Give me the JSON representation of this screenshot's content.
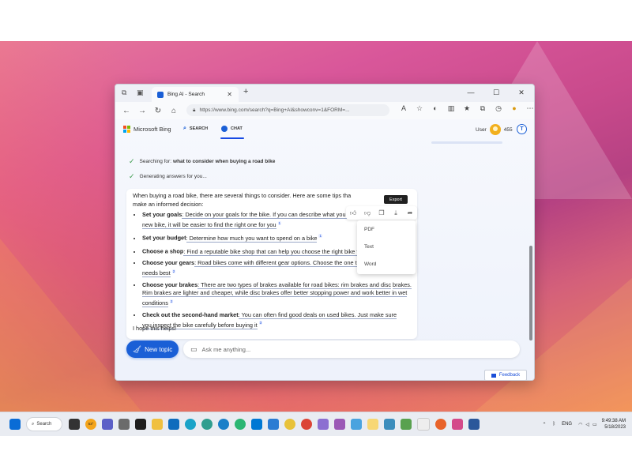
{
  "browser": {
    "tab_title": "Bing AI - Search",
    "url": "https://www.bing.com/search?q=Bing+AI&showconv=1&FORM=...",
    "new_tab": "+"
  },
  "bing": {
    "brand": "Microsoft Bing",
    "tabs": [
      "SEARCH",
      "CHAT"
    ],
    "active_tab": "CHAT",
    "user_label": "User",
    "points": "455"
  },
  "status": {
    "searching_prefix": "Searching for: ",
    "searching_query": "what to consider when buying a road bike",
    "generating": "Generating answers for you..."
  },
  "answer": {
    "intro": "When buying a road bike, there are several things to consider. Here are some tips tha",
    "intro2": "make an informed decision:",
    "items": [
      {
        "bold": "Set your goals",
        "text": ": Decide on your goals for the bike. If you can describe what you w",
        "text2": "new bike, it will be easier to find the right one for you",
        "ref": "1"
      },
      {
        "bold": "Set your budget",
        "text": ": Determine how much you want to spend on a bike",
        "text2": "",
        "ref": "1"
      },
      {
        "bold": "Choose a shop",
        "text": ": Find a reputable bike shop that can help you choose the right bike for your needs",
        "text2": "",
        "ref": "1"
      },
      {
        "bold": "Choose your gears",
        "text": ": Road bikes come with different gear options. Choose the one that suits your",
        "text2": "needs best",
        "ref": "2"
      },
      {
        "bold": "Choose your brakes",
        "text": ": There are two types of brakes available for road bikes: rim brakes and disc",
        "text2": "brakes. Rim brakes are lighter and cheaper, while disc brakes offer better stopping power and work better in wet conditions",
        "ref": "2"
      },
      {
        "bold": "Check out the second-hand market",
        "text": ": You can often find good deals on used bikes. Just make sure",
        "text2": "you inspect the bike carefully before buying it",
        "ref": "3"
      }
    ],
    "outro": "I hope this helps!"
  },
  "export": {
    "tooltip": "Export",
    "options": [
      "PDF",
      "Text",
      "Word"
    ]
  },
  "compose": {
    "new_topic": "New topic",
    "placeholder": "Ask me anything..."
  },
  "feedback": "Feedback",
  "taskbar": {
    "search": "Search",
    "weather": "53°",
    "lang": "ENG",
    "time": "9:49:38 AM",
    "date": "5/18/2023"
  },
  "colors": {
    "accent": "#1a5fd6",
    "check": "#3a9a4a"
  }
}
